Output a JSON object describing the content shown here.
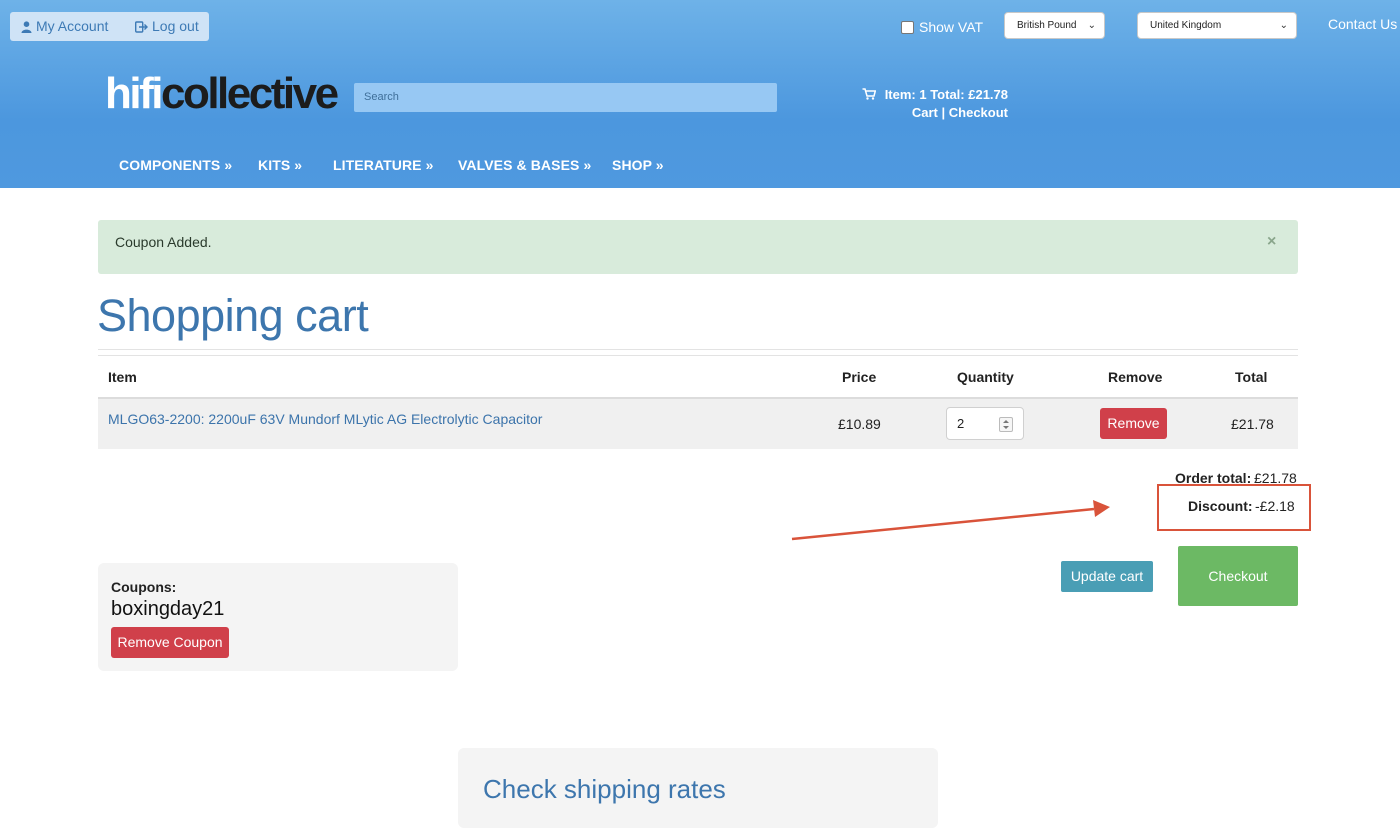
{
  "topbar": {
    "my_account": "My Account",
    "log_out": "Log out",
    "show_vat_label": "Show VAT",
    "show_vat_checked": false,
    "currency_selected": "British Pound",
    "country_selected": "United Kingdom",
    "contact_us": "Contact Us"
  },
  "logo": {
    "part1": "hifi",
    "part2": "collective"
  },
  "search": {
    "placeholder": "Search"
  },
  "mini_cart": {
    "summary": "Item: 1 Total: £21.78",
    "cart_link": "Cart",
    "separator": " | ",
    "checkout_link": "Checkout"
  },
  "nav": [
    {
      "label": "COMPONENTS »"
    },
    {
      "label": "KITS »"
    },
    {
      "label": "LITERATURE »"
    },
    {
      "label": "VALVES & BASES »"
    },
    {
      "label": "SHOP »"
    }
  ],
  "alert": {
    "message": "Coupon Added.",
    "close": "×"
  },
  "page_title": "Shopping cart",
  "table": {
    "headers": {
      "item": "Item",
      "price": "Price",
      "quantity": "Quantity",
      "remove": "Remove",
      "total": "Total"
    },
    "rows": [
      {
        "item": "MLGO63-2200: 2200uF 63V Mundorf MLytic AG Electrolytic Capacitor",
        "price": "£10.89",
        "quantity": "2",
        "remove_label": "Remove",
        "total": "£21.78"
      }
    ]
  },
  "summary": {
    "order_total_label": "Order total:",
    "order_total_value": "£21.78",
    "discount_label": "Discount:",
    "discount_value": "-£2.18"
  },
  "actions": {
    "update_cart": "Update cart",
    "checkout": "Checkout"
  },
  "coupons": {
    "label": "Coupons:",
    "code": "boxingday21",
    "remove_label": "Remove Coupon"
  },
  "shipping": {
    "title": "Check shipping rates"
  },
  "colors": {
    "header_blue": "#4f99df",
    "link_blue": "#3c74ab",
    "danger_red": "#d0404a",
    "update_teal": "#4a9eb5",
    "checkout_green": "#6cb964",
    "annotation_red": "#d9533a"
  }
}
